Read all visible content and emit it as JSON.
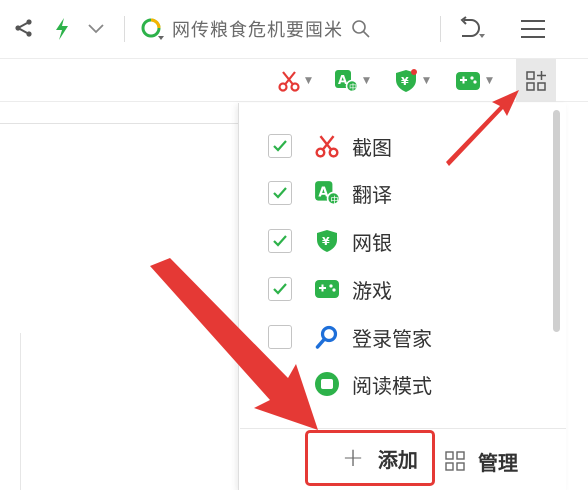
{
  "toolbar": {
    "search_text": "网传粮食危机要囤米",
    "icons": [
      "share-icon",
      "bolt-icon",
      "chevron-down-icon",
      "search-engine-icon",
      "search-icon",
      "undo-icon",
      "menu-icon"
    ]
  },
  "plugin_bar": {
    "items": [
      "screenshot-icon",
      "translate-icon",
      "bank-icon",
      "game-icon"
    ],
    "manage_icon": "plugin-manage-icon"
  },
  "dropdown": {
    "items": [
      {
        "label": "截图",
        "checked": true,
        "icon": "scissors-icon",
        "color": "#e53935"
      },
      {
        "label": "翻译",
        "checked": true,
        "icon": "translate-icon",
        "color": "#2db24a"
      },
      {
        "label": "网银",
        "checked": true,
        "icon": "shield-yuan-icon",
        "color": "#2db24a"
      },
      {
        "label": "游戏",
        "checked": true,
        "icon": "gamepad-icon",
        "color": "#2db24a"
      },
      {
        "label": "登录管家",
        "checked": false,
        "icon": "key-icon",
        "color": "#1e6fd9"
      },
      {
        "label": "阅读模式",
        "checked": false,
        "icon": "reader-icon",
        "color": "#2db24a"
      }
    ],
    "add_label": "添加",
    "manage_label": "管理"
  },
  "colors": {
    "accent_green": "#2db24a",
    "highlight_red": "#e53935"
  }
}
